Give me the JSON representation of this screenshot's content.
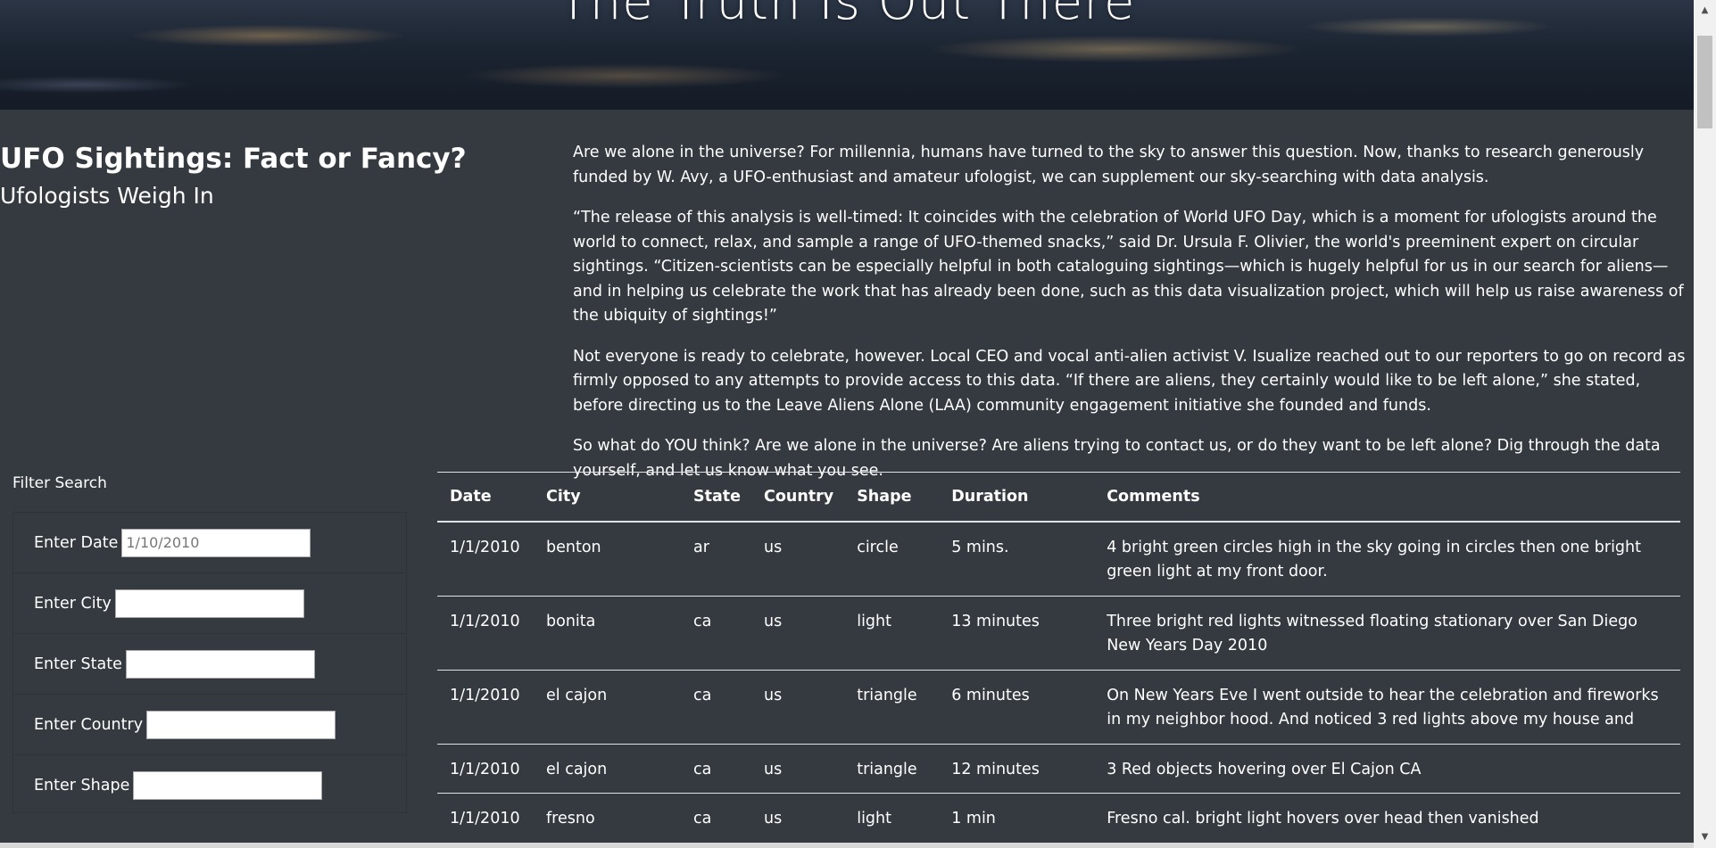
{
  "hero": {
    "title": "The Truth Is Out There"
  },
  "heading": {
    "title": "UFO Sightings: Fact or Fancy?",
    "subtitle": "Ufologists Weigh In"
  },
  "article": {
    "paragraphs": [
      "Are we alone in the universe? For millennia, humans have turned to the sky to answer this question. Now, thanks to research generously funded by W. Avy, a UFO-enthusiast and amateur ufologist, we can supplement our sky-searching with data analysis.",
      "“The release of this analysis is well-timed: It coincides with the celebration of World UFO Day, which is a moment for ufologists around the world to connect, relax, and sample a range of UFO-themed snacks,” said Dr. Ursula F. Olivier, the world's preeminent expert on circular sightings. “Citizen-scientists can be especially helpful in both cataloguing sightings—which is hugely helpful for us in our search for aliens—and in helping us celebrate the work that has already been done, such as this data visualization project, which will help us raise awareness of the ubiquity of sightings!”",
      "Not everyone is ready to celebrate, however. Local CEO and vocal anti-alien activist V. Isualize reached out to our reporters to go on record as firmly opposed to any attempts to provide access to this data. “If there are aliens, they certainly would like to be left alone,” she stated, before directing us to the Leave Aliens Alone (LAA) community engagement initiative she founded and funds.",
      "So what do YOU think? Are we alone in the universe? Are aliens trying to contact us, or do they want to be left alone? Dig through the data yourself, and let us know what you see."
    ]
  },
  "filter": {
    "title": "Filter Search",
    "fields": [
      {
        "label": "Enter Date",
        "placeholder": "1/10/2010",
        "value": ""
      },
      {
        "label": "Enter City",
        "placeholder": "",
        "value": ""
      },
      {
        "label": "Enter State",
        "placeholder": "",
        "value": ""
      },
      {
        "label": "Enter Country",
        "placeholder": "",
        "value": ""
      },
      {
        "label": "Enter Shape",
        "placeholder": "",
        "value": ""
      }
    ]
  },
  "table": {
    "headers": [
      "Date",
      "City",
      "State",
      "Country",
      "Shape",
      "Duration",
      "Comments"
    ],
    "rows": [
      [
        "1/1/2010",
        "benton",
        "ar",
        "us",
        "circle",
        "5 mins.",
        "4 bright green circles high in the sky going in circles then one bright green light at my front door."
      ],
      [
        "1/1/2010",
        "bonita",
        "ca",
        "us",
        "light",
        "13 minutes",
        "Three bright red lights witnessed floating stationary over San Diego New Years Day 2010"
      ],
      [
        "1/1/2010",
        "el cajon",
        "ca",
        "us",
        "triangle",
        "6 minutes",
        "On New Years Eve I went outside to hear the celebration and fireworks in my neighbor hood. And noticed 3 red lights above my house and"
      ],
      [
        "1/1/2010",
        "el cajon",
        "ca",
        "us",
        "triangle",
        "12 minutes",
        "3 Red objects hovering over El Cajon CA"
      ],
      [
        "1/1/2010",
        "fresno",
        "ca",
        "us",
        "light",
        "1 min",
        "Fresno cal. bright light hovers over head then vanished"
      ]
    ]
  },
  "scrollbar": {
    "up_icon": "▲",
    "down_icon": "▼"
  }
}
